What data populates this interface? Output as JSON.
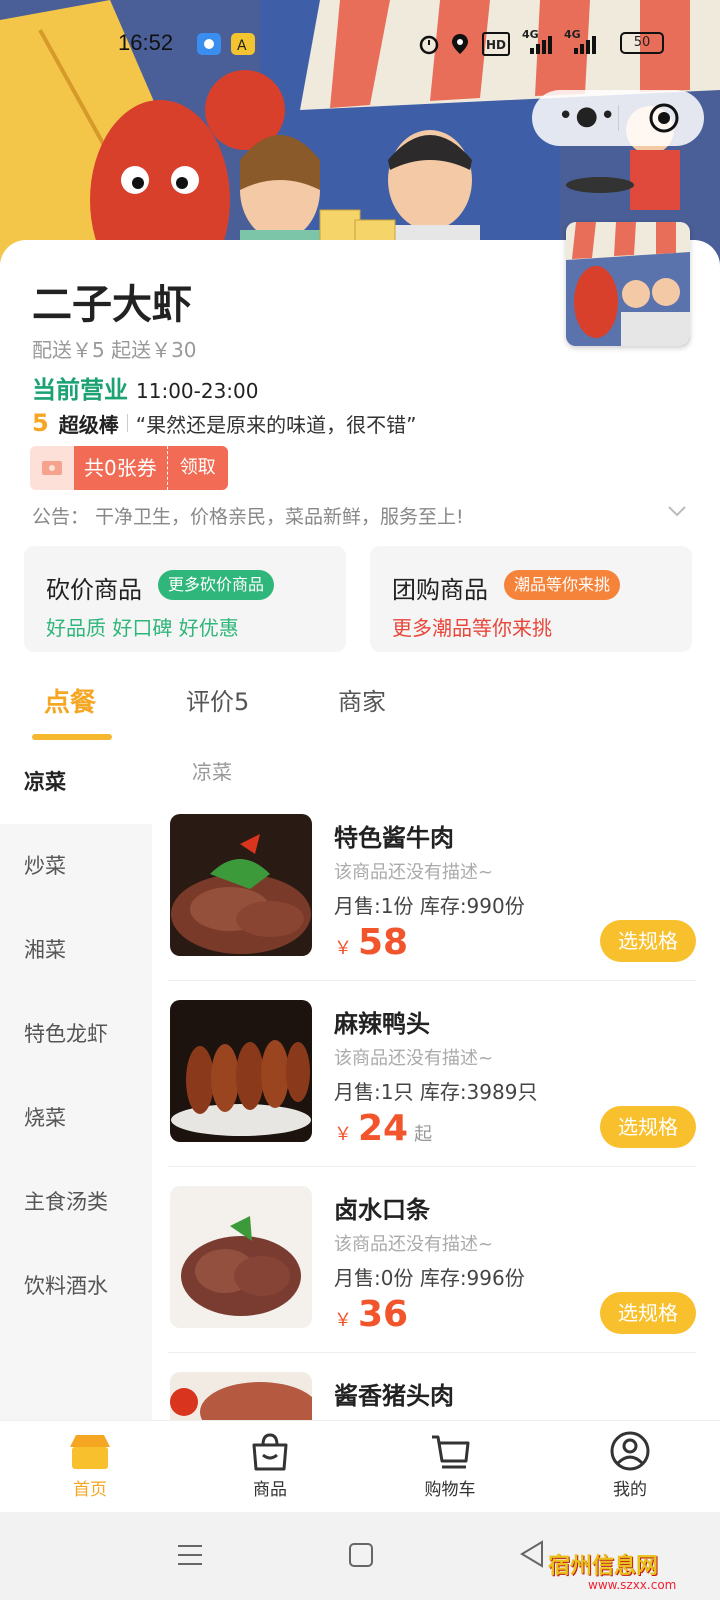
{
  "status_bar": {
    "time": "16:52",
    "network_1": "4G",
    "network_2": "4G",
    "hd_label": "HD",
    "battery": "50"
  },
  "shop": {
    "name": "二子大虾",
    "fee": "配送￥5   起送￥30",
    "open_label": "当前营业",
    "open_hours": "11:00-23:00",
    "rating": "5",
    "rating_tag": "超级棒",
    "review_quote": "“果然还是原来的味道，很不错”",
    "coupon_text": "共0张券",
    "coupon_action": "领取",
    "notice": "公告：  干净卫生，价格亲民，菜品新鲜，服务至上!"
  },
  "promos": [
    {
      "title": "砍价商品",
      "badge": "更多砍价商品",
      "subtitle": "好品质 好口碑 好优惠",
      "badge_color": "#2fb67a",
      "sub_color": "#2fb67a"
    },
    {
      "title": "团购商品",
      "badge": "潮品等你来挑",
      "subtitle": "更多潮品等你来挑",
      "badge_color": "#f5833a",
      "sub_color": "#e8463a"
    }
  ],
  "tabs": [
    {
      "label": "点餐"
    },
    {
      "label": "评价5"
    },
    {
      "label": "商家"
    }
  ],
  "categories": [
    "凉菜",
    "炒菜",
    "湘菜",
    "特色龙虾",
    "烧菜",
    "主食汤类",
    "饮料酒水"
  ],
  "section_title": "凉菜",
  "dishes": [
    {
      "name": "特色酱牛肉",
      "desc": "该商品还没有描述~",
      "sales": "月售:1份    库存:990份",
      "currency": "￥",
      "price": "58",
      "suffix": "",
      "action": "选规格"
    },
    {
      "name": "麻辣鸭头",
      "desc": "该商品还没有描述~",
      "sales": "月售:1只    库存:3989只",
      "currency": "￥",
      "price": "24",
      "suffix": "起",
      "action": "选规格"
    },
    {
      "name": "卤水口条",
      "desc": "该商品还没有描述~",
      "sales": "月售:0份    库存:996份",
      "currency": "￥",
      "price": "36",
      "suffix": "",
      "action": "选规格"
    },
    {
      "name": "酱香猪头肉"
    }
  ],
  "bottom_nav": [
    {
      "label": "首页",
      "icon": "home-store-icon"
    },
    {
      "label": "商品",
      "icon": "bag-icon"
    },
    {
      "label": "购物车",
      "icon": "cart-icon"
    },
    {
      "label": "我的",
      "icon": "profile-icon"
    }
  ],
  "watermark": {
    "text": "宿州信息网",
    "url": "www.szxx.com"
  },
  "colors": {
    "accent": "#f5a623",
    "price": "#f2552c",
    "open": "#1aa272",
    "spec_button": "#f9c02e",
    "coupon": "#f26b55"
  }
}
